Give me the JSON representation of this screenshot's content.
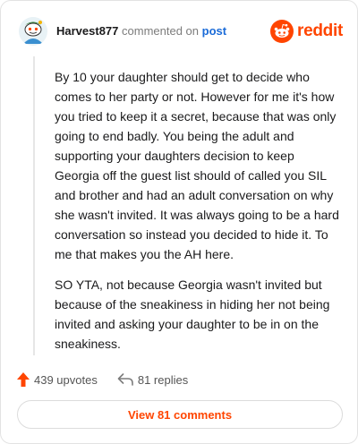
{
  "comment": {
    "username": "Harvest877",
    "action_text": "commented on",
    "post_link_text": "post",
    "brand": "reddit",
    "paragraphs": [
      "By 10 your daughter should get to decide who comes to her party or not. However for me it's how you tried to keep it a secret, because that was only going to end badly. You being the adult and supporting your daughters decision to keep Georgia off the guest list should of called you SIL and brother and had an adult conversation on why she wasn't invited. It was always going to be a hard conversation so instead you decided to hide it. To me that makes you the AH here.",
      "SO YTA, not because Georgia wasn't invited but because of the sneakiness in hiding her not being invited and asking your daughter to be in on the sneakiness."
    ],
    "upvotes_text": "439 upvotes",
    "replies_text": "81 replies",
    "view_comments_label": "View 81 comments"
  },
  "colors": {
    "brand": "#ff4500",
    "link": "#1a6bd8",
    "muted": "#7c7c7c"
  },
  "icons": {
    "upvote": "upvote-arrow-icon",
    "reply": "reply-arrow-icon",
    "logo": "reddit-snoo-icon",
    "avatar": "snoo-avatar-icon"
  }
}
